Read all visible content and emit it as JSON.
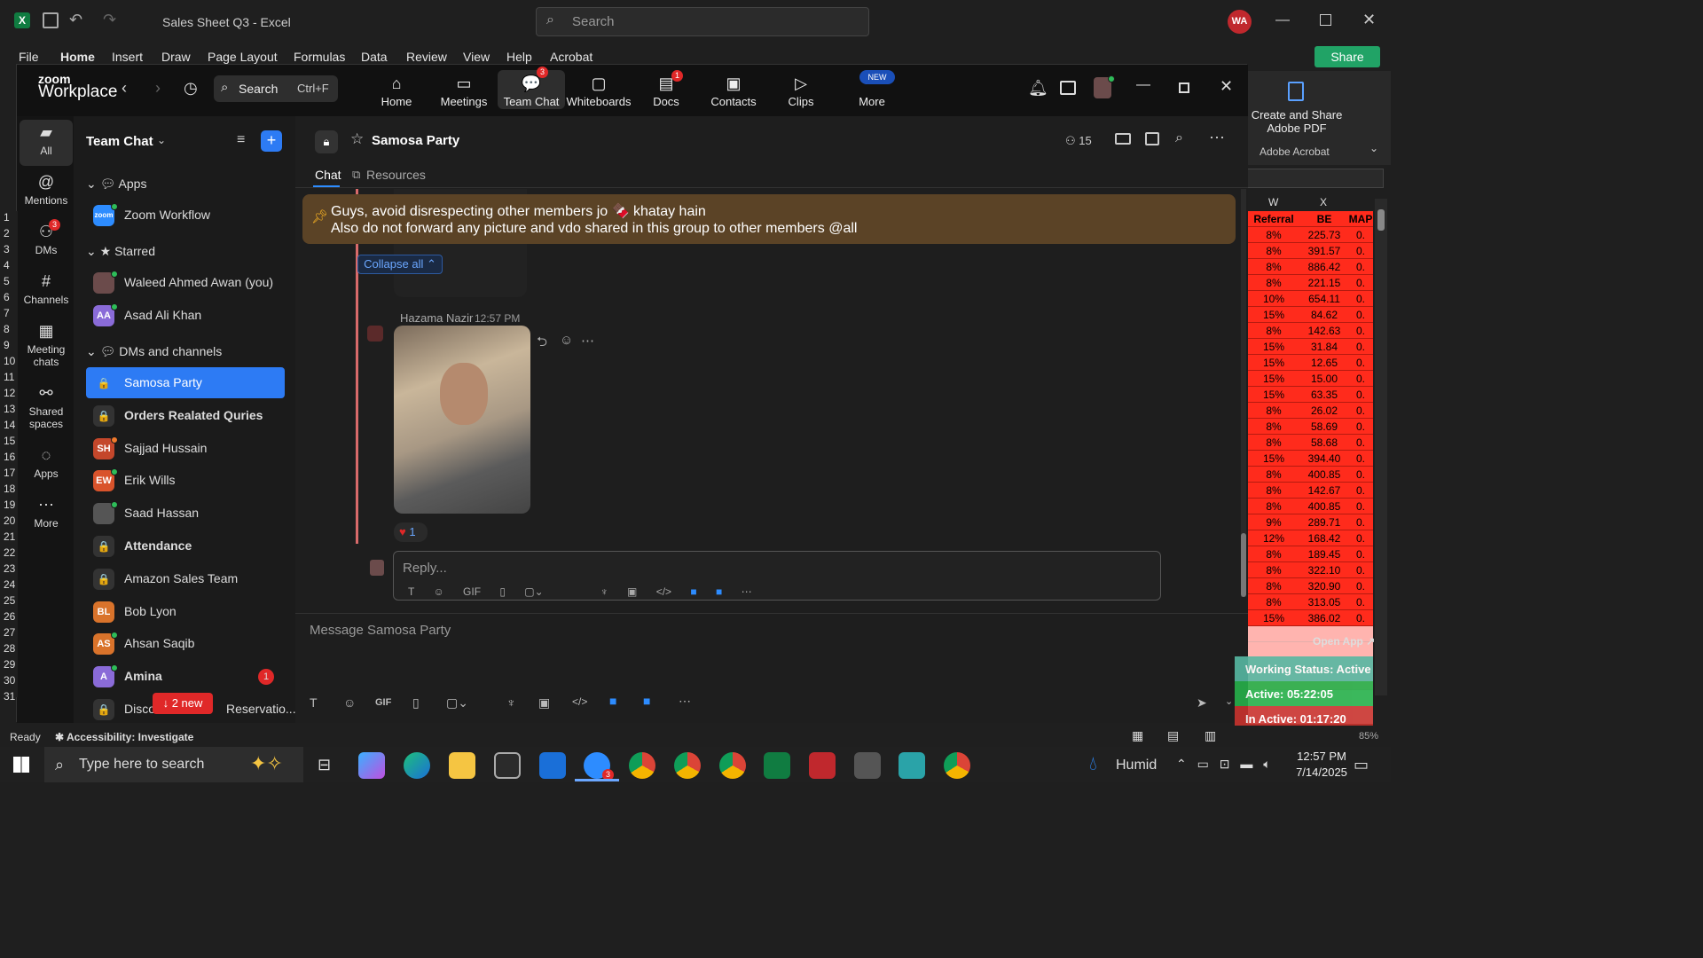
{
  "excel": {
    "title": "Sales Sheet Q3  -  Excel",
    "search_placeholder": "Search",
    "avatar": "WA",
    "share": "Share",
    "menu": [
      "File",
      "Home",
      "Insert",
      "Draw",
      "Page Layout",
      "Formulas",
      "Data",
      "Review",
      "View",
      "Help",
      "Acrobat"
    ],
    "acrobat_title": "Create and Share Adobe PDF",
    "acrobat_group": "Adobe Acrobat",
    "col_letters": [
      "W",
      "X"
    ],
    "col_headers": [
      "Referral",
      "BE",
      "MAP"
    ],
    "rows": [
      [
        "8%",
        "225.73",
        "0."
      ],
      [
        "8%",
        "391.57",
        "0."
      ],
      [
        "8%",
        "886.42",
        "0."
      ],
      [
        "8%",
        "221.15",
        "0."
      ],
      [
        "10%",
        "654.11",
        "0."
      ],
      [
        "15%",
        "84.62",
        "0."
      ],
      [
        "8%",
        "142.63",
        "0."
      ],
      [
        "15%",
        "31.84",
        "0."
      ],
      [
        "15%",
        "12.65",
        "0."
      ],
      [
        "15%",
        "15.00",
        "0."
      ],
      [
        "15%",
        "63.35",
        "0."
      ],
      [
        "8%",
        "26.02",
        "0."
      ],
      [
        "8%",
        "58.69",
        "0."
      ],
      [
        "8%",
        "58.68",
        "0."
      ],
      [
        "15%",
        "394.40",
        "0."
      ],
      [
        "8%",
        "400.85",
        "0."
      ],
      [
        "8%",
        "142.67",
        "0."
      ],
      [
        "8%",
        "400.85",
        "0."
      ],
      [
        "9%",
        "289.71",
        "0."
      ],
      [
        "12%",
        "168.42",
        "0."
      ],
      [
        "8%",
        "189.45",
        "0."
      ],
      [
        "8%",
        "322.10",
        "0."
      ],
      [
        "8%",
        "320.90",
        "0."
      ],
      [
        "8%",
        "313.05",
        "0."
      ],
      [
        "15%",
        "386.02",
        "0."
      ]
    ],
    "row_numbers": [
      "1",
      "2",
      "3",
      "4",
      "5",
      "6",
      "7",
      "8",
      "9",
      "10",
      "11",
      "12",
      "13",
      "14",
      "15",
      "16",
      "17",
      "18",
      "19",
      "20",
      "21",
      "22",
      "23",
      "24",
      "25",
      "26",
      "27",
      "28",
      "29",
      "30",
      "31"
    ],
    "status_ready": "Ready",
    "accessibility": "Accessibility: Investigate",
    "zoom_pct": "85%"
  },
  "zoom": {
    "brand_top": "zoom",
    "brand": "Workplace",
    "search": "Search",
    "search_shortcut": "Ctrl+F",
    "nav": [
      {
        "label": "Home",
        "icon": "home-icon",
        "glyph": "⌂",
        "badge": ""
      },
      {
        "label": "Meetings",
        "icon": "video-icon",
        "glyph": "▭",
        "badge": ""
      },
      {
        "label": "Team Chat",
        "icon": "chat-icon",
        "glyph": "💬",
        "badge": "3"
      },
      {
        "label": "Whiteboards",
        "icon": "whiteboard-icon",
        "glyph": "▢",
        "badge": ""
      },
      {
        "label": "Docs",
        "icon": "docs-icon",
        "glyph": "▤",
        "badge": "1"
      },
      {
        "label": "Contacts",
        "icon": "contacts-icon",
        "glyph": "▣",
        "badge": ""
      },
      {
        "label": "Clips",
        "icon": "clips-icon",
        "glyph": "▷",
        "badge": ""
      },
      {
        "label": "More",
        "icon": "more-icon",
        "glyph": "⋯",
        "badge": "NEW"
      }
    ],
    "left_nav": [
      {
        "label": "All",
        "glyph": "▰"
      },
      {
        "label": "Mentions",
        "glyph": "@"
      },
      {
        "label": "DMs",
        "glyph": "⚇"
      },
      {
        "label": "Channels",
        "glyph": "#"
      },
      {
        "label": "Meeting chats",
        "glyph": "▦"
      },
      {
        "label": "Shared spaces",
        "glyph": "⚯"
      },
      {
        "label": "Apps",
        "glyph": "◌"
      },
      {
        "label": "More",
        "glyph": "⋯"
      }
    ],
    "dms_badge": "3",
    "list_title": "Team Chat",
    "sections": {
      "apps": "Apps",
      "starred": "Starred",
      "dms": "DMs and channels"
    },
    "apps": [
      {
        "name": "Zoom Workflow",
        "av": "zoom",
        "color": "#2d8cff"
      }
    ],
    "starred": [
      {
        "name": "Waleed Ahmed Awan (you)",
        "av": "",
        "color": "#6b4b4b"
      },
      {
        "name": "Asad Ali Khan",
        "av": "AA",
        "color": "#8a6bd8"
      }
    ],
    "dms": [
      {
        "name": "Samosa Party",
        "av": "🔒",
        "color": "transparent",
        "bold": false,
        "active": true
      },
      {
        "name": "Orders Realated Quries",
        "av": "🔒",
        "color": "#333",
        "bold": true
      },
      {
        "name": "Sajjad Hussain",
        "av": "SH",
        "color": "#c4472b",
        "bold": false
      },
      {
        "name": "Erik Wills",
        "av": "EW",
        "color": "#d9532b",
        "bold": false
      },
      {
        "name": "Saad Hassan",
        "av": "",
        "color": "#555",
        "bold": false
      },
      {
        "name": "Attendance",
        "av": "🔒",
        "color": "#333",
        "bold": true
      },
      {
        "name": "Amazon Sales Team",
        "av": "🔒",
        "color": "#333",
        "bold": false
      },
      {
        "name": "Bob Lyon",
        "av": "BL",
        "color": "#d9732b",
        "bold": false
      },
      {
        "name": "Ahsan Saqib",
        "av": "AS",
        "color": "#d9732b",
        "bold": false
      },
      {
        "name": "Amina",
        "av": "A",
        "color": "#8a6bd8",
        "bold": true,
        "badge": "1"
      },
      {
        "name": "Discou",
        "av": "🔒",
        "color": "#333",
        "bold": false,
        "suffix": "Reservatio..."
      }
    ],
    "new_pill": "↓ 2 new",
    "channel": {
      "name": "Samosa Party",
      "members": "15",
      "tab_chat": "Chat",
      "tab_resources": "Resources",
      "pinned_line1": "Guys, avoid disrespecting other members jo 🍫 khatay hain",
      "pinned_line2": "Also do not forward any picture and vdo shared in this group to other members @all",
      "collapse": "Collapse all ⌃",
      "sender": "Hazama Nazir",
      "time": "12:57 PM",
      "reaction": "1",
      "reply_placeholder": "Reply...",
      "message_placeholder": "Message Samosa Party"
    }
  },
  "overlay": {
    "open_app": "Open App ↗",
    "working": "Working Status: Active",
    "active": "Active: 05:22:05",
    "inactive": "In Active: 01:17:20"
  },
  "taskbar": {
    "search": "Type here to search",
    "weather": "Humid",
    "time": "12:57 PM",
    "date": "7/14/2025",
    "zoom_badge": "3"
  }
}
